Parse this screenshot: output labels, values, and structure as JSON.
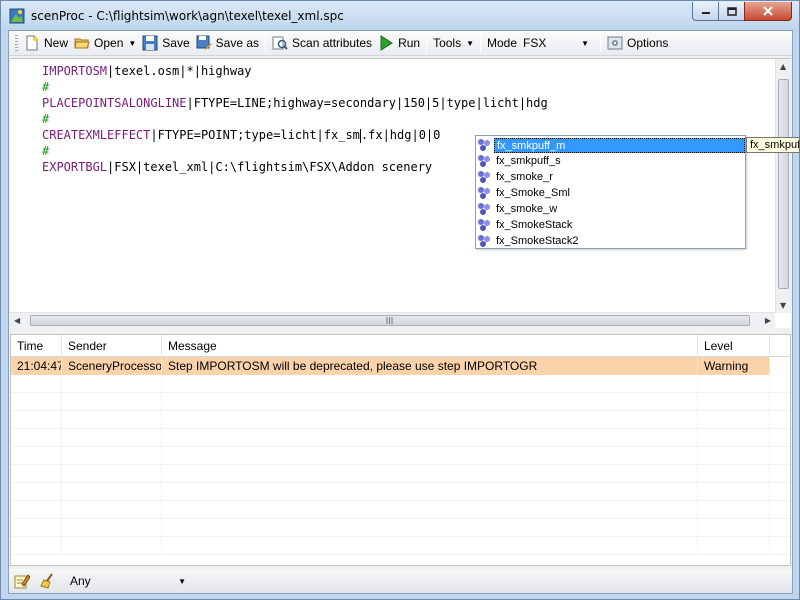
{
  "window": {
    "title": "scenProc - C:\\flightsim\\work\\agn\\texel\\texel_xml.spc",
    "min_label": "minimize",
    "max_label": "maximize",
    "close_label": "close"
  },
  "toolbar": {
    "new_label": "New",
    "open_label": "Open",
    "save_label": "Save",
    "saveas_label": "Save as",
    "scan_label": "Scan attributes",
    "run_label": "Run",
    "tools_label": "Tools",
    "mode_label": "Mode",
    "mode_value": "FSX",
    "options_label": "Options"
  },
  "editor": {
    "lines": [
      {
        "kw": "IMPORTOSM",
        "rest": "|texel.osm|*|highway"
      },
      {
        "comment": "#"
      },
      {
        "kw": "PLACEPOINTSALONGLINE",
        "rest": "|FTYPE=LINE;highway=secondary|150|5|type|licht|hdg"
      },
      {
        "comment": "#"
      },
      {
        "kw": "CREATEXMLEFFECT",
        "rest_before": "|FTYPE=POINT;type=licht|fx_sm",
        "rest_after": ".fx|hdg|0|0"
      },
      {
        "comment": "#"
      },
      {
        "kw": "EXPORTBGL",
        "rest": "|FSX|texel_xml|C:\\flightsim\\FSX\\Addon scenery"
      }
    ]
  },
  "autocomplete": {
    "items": [
      "fx_smkpuff_m",
      "fx_smkpuff_s",
      "fx_smoke_r",
      "fx_Smoke_Sml",
      "fx_smoke_w",
      "fx_SmokeStack",
      "fx_SmokeStack2"
    ],
    "selected_index": 0,
    "tooltip": "fx_smkpuff_m"
  },
  "log": {
    "headers": [
      "Time",
      "Sender",
      "Message",
      "Level"
    ],
    "rows": [
      {
        "time": "21:04:47",
        "sender": "SceneryProcessor",
        "message": "Step IMPORTOSM will be deprecated, please use step IMPORTOGR",
        "level": "Warning"
      }
    ]
  },
  "statusbar": {
    "filter_value": "Any"
  },
  "colors": {
    "keyword": "#7b1b7e",
    "comment": "#1e8f1e",
    "warning_row": "#fbd3ab",
    "selection": "#3399ff"
  }
}
